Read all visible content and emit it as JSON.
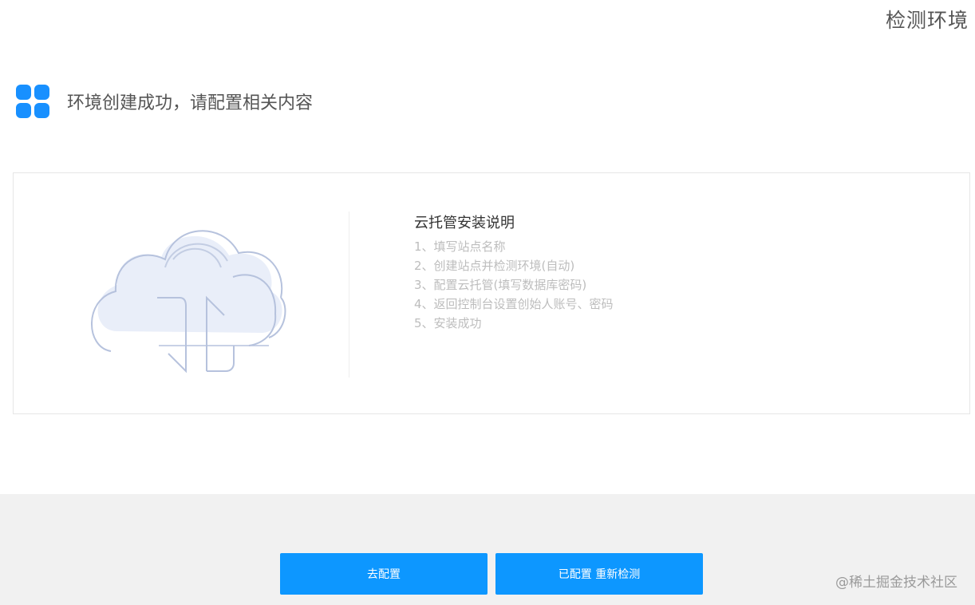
{
  "header": {
    "title": "检测环境"
  },
  "status": {
    "icon": "apps-grid-icon",
    "message": "环境创建成功，请配置相关内容",
    "accent_color": "#1890ff"
  },
  "card": {
    "illustration": "cloud-sync-icon",
    "guide": {
      "title": "云托管安装说明",
      "steps": [
        "1、填写站点名称",
        "2、创建站点并检测环境(自动)",
        "3、配置云托管(填写数据库密码)",
        "4、返回控制台设置创始人账号、密码",
        "5、安装成功"
      ]
    }
  },
  "footer": {
    "buttons": {
      "configure": "去配置",
      "recheck": "已配置 重新检测"
    },
    "button_color": "#0d97ff",
    "watermark": "@稀土掘金技术社区"
  }
}
